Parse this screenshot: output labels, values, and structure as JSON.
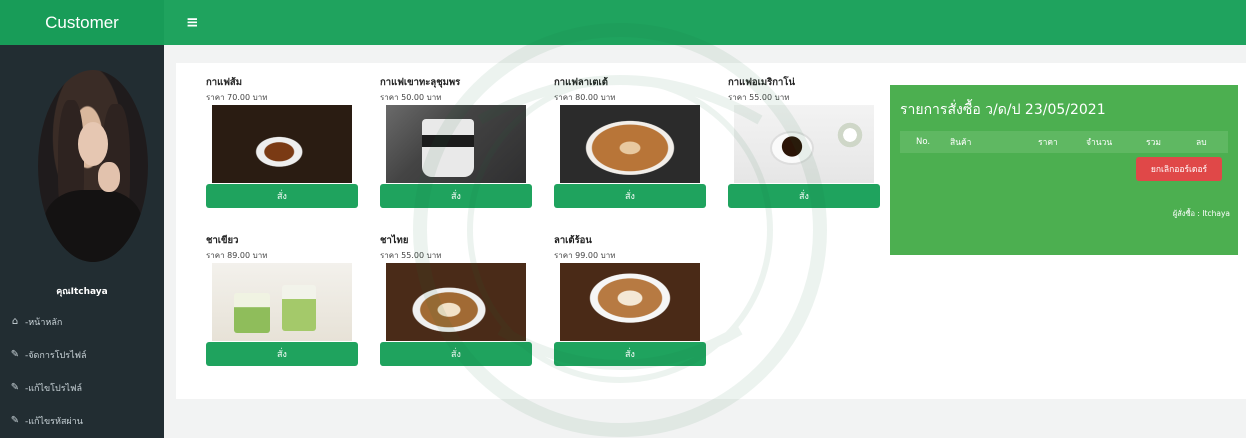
{
  "sidebar": {
    "brand": "Customer",
    "username": "คุณItchaya",
    "menu": [
      {
        "icon": "home-icon",
        "label": "-หน้าหลัก"
      },
      {
        "icon": "edit-icon",
        "label": "-จัดการโปรไฟล์"
      },
      {
        "icon": "edit-icon",
        "label": "-แก้ไขโปรไฟล์"
      },
      {
        "icon": "edit-icon",
        "label": "-แก้ไขรหัสผ่าน"
      }
    ]
  },
  "header": {
    "menu_icon": "hamburger-menu-icon"
  },
  "products": [
    {
      "name": "กาแฟส้ม",
      "price": "ราคา 70.00 บาท",
      "button": "สั่ง"
    },
    {
      "name": "กาแฟเขาทะลุชุมพร",
      "price": "ราคา 50.00 บาท",
      "button": "สั่ง"
    },
    {
      "name": "กาแฟลาเตเต้",
      "price": "ราคา 80.00 บาท",
      "button": "สั่ง"
    },
    {
      "name": "กาแฟอเมริกาโน่",
      "price": "ราคา 55.00 บาท",
      "button": "สั่ง"
    },
    {
      "name": "ชาเขียว",
      "price": "ราคา 89.00 บาท",
      "button": "สั่ง"
    },
    {
      "name": "ชาไทย",
      "price": "ราคา 55.00 บาท",
      "button": "สั่ง"
    },
    {
      "name": "ลาเต้ร้อน",
      "price": "ราคา 99.00 บาท",
      "button": "สั่ง"
    }
  ],
  "order": {
    "title": "รายการสั่งซื้อ ว/ด/ป 23/05/2021",
    "columns": [
      "No.",
      "สินค้า",
      "ราคา",
      "จำนวน",
      "รวม",
      "ลบ"
    ],
    "cancel_button": "ยกเลิกออร์เดอร์",
    "buyer": "ผู้สั่งซื้อ : Itchaya"
  },
  "colors": {
    "sidebar": "#222d32",
    "header": "#1fa35e",
    "order_panel": "#4caf50",
    "cancel": "#e04848"
  }
}
